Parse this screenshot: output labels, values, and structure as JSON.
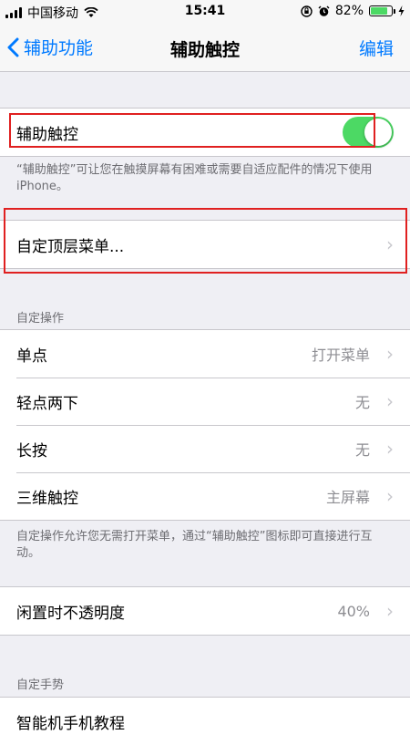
{
  "status_bar": {
    "carrier": "中国移动",
    "time": "15:41",
    "battery": "82%",
    "battery_level": 0.82,
    "icons": [
      "signal-icon",
      "wifi-icon",
      "orientation-lock-icon",
      "alarm-icon",
      "battery-icon",
      "charging-icon"
    ]
  },
  "nav": {
    "back_label": "辅助功能",
    "title": "辅助触控",
    "edit_label": "编辑"
  },
  "assistive_touch": {
    "label": "辅助触控",
    "enabled": true,
    "footer": "“辅助触控”可让您在触摸屏幕有困难或需要自适应配件的情况下使用 iPhone。"
  },
  "customize_menu": {
    "label": "自定顶层菜单..."
  },
  "custom_actions": {
    "header": "自定操作",
    "items": [
      {
        "label": "单点",
        "value": "打开菜单"
      },
      {
        "label": "轻点两下",
        "value": "无"
      },
      {
        "label": "长按",
        "value": "无"
      },
      {
        "label": "三维触控",
        "value": "主屏幕"
      }
    ],
    "footer": "自定操作允许您无需打开菜单，通过“辅助触控”图标即可直接进行互动。"
  },
  "idle_opacity": {
    "label": "闲置时不透明度",
    "value": "40%"
  },
  "custom_gestures": {
    "header": "自定手势",
    "first_item": "智能机手机教程"
  },
  "colors": {
    "accent": "#007aff",
    "toggle_on": "#4cd964",
    "highlight": "#e02020"
  }
}
